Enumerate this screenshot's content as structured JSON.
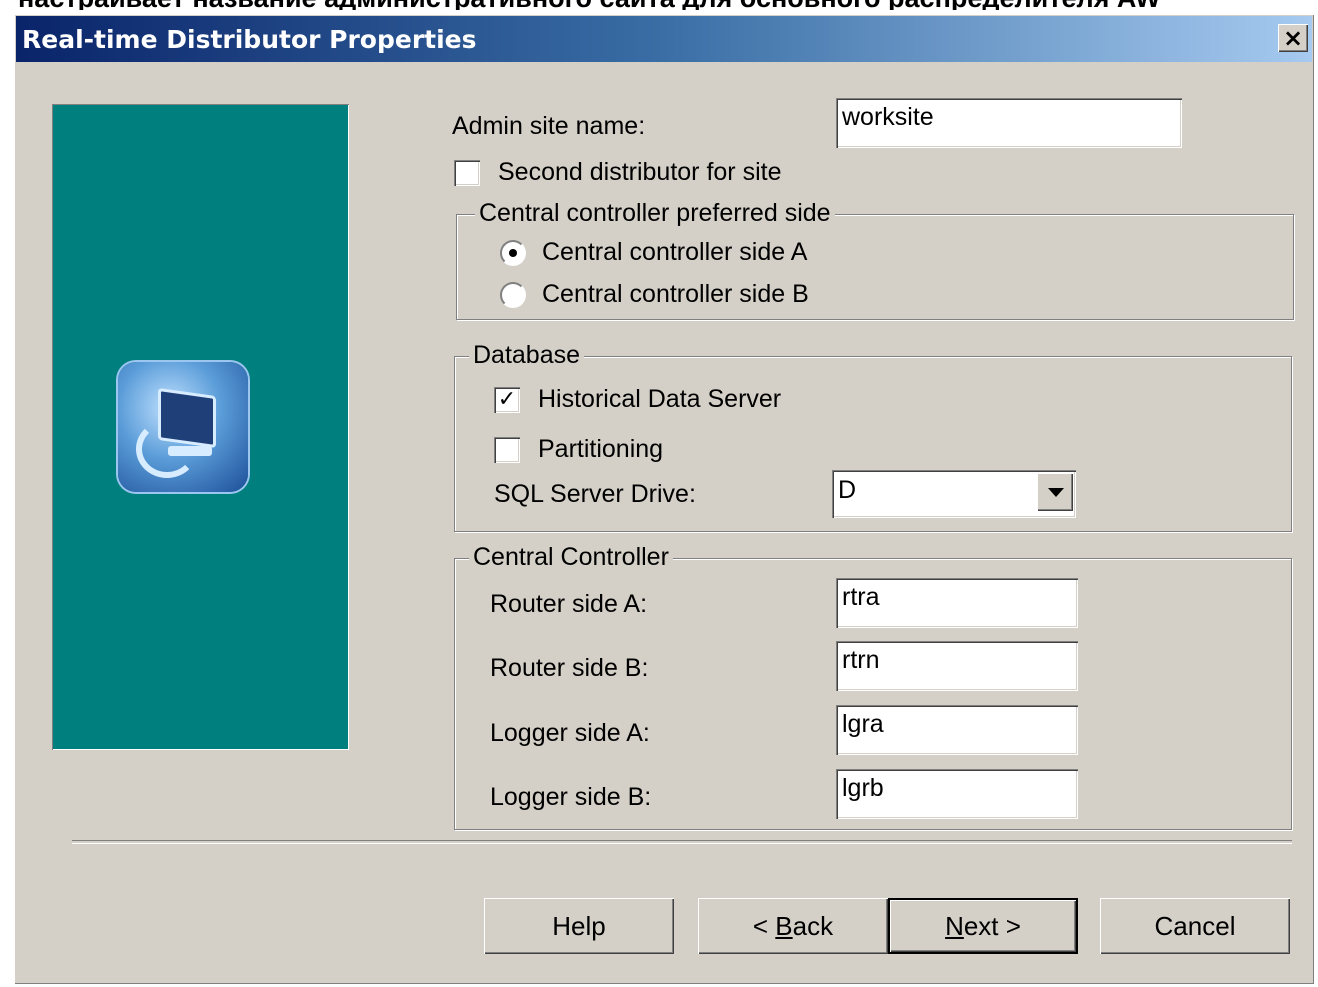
{
  "caption": "настраивает название административного сайта для основного распределителя AW",
  "window": {
    "title": "Real-time Distributor Properties",
    "close_label": "×"
  },
  "form": {
    "admin_site_label": "Admin site name:",
    "admin_site_value": "worksite",
    "second_distributor_label": "Second distributor for site",
    "second_distributor_checked": false
  },
  "preferred_side": {
    "group_title": "Central controller preferred side",
    "options": [
      {
        "label": "Central controller side A",
        "selected": true
      },
      {
        "label": "Central controller side B",
        "selected": false
      }
    ]
  },
  "database": {
    "group_title": "Database",
    "historical_label": "Historical Data Server",
    "historical_checked": true,
    "partitioning_label": "Partitioning",
    "partitioning_checked": false,
    "sql_drive_label": "SQL Server Drive:",
    "sql_drive_value": "D"
  },
  "central_controller": {
    "group_title": "Central Controller",
    "router_a_label": "Router side A:",
    "router_a_value": "rtra",
    "router_b_label": "Router side B:",
    "router_b_value": "rtrn",
    "logger_a_label": "Logger side A:",
    "logger_a_value": "lgra",
    "logger_b_label": "Logger side B:",
    "logger_b_value": "lgrb"
  },
  "buttons": {
    "help": "Help",
    "back_prefix": "< ",
    "back_accel": "B",
    "back_rest": "ack",
    "next_accel": "N",
    "next_rest": "ext >",
    "cancel": "Cancel"
  }
}
